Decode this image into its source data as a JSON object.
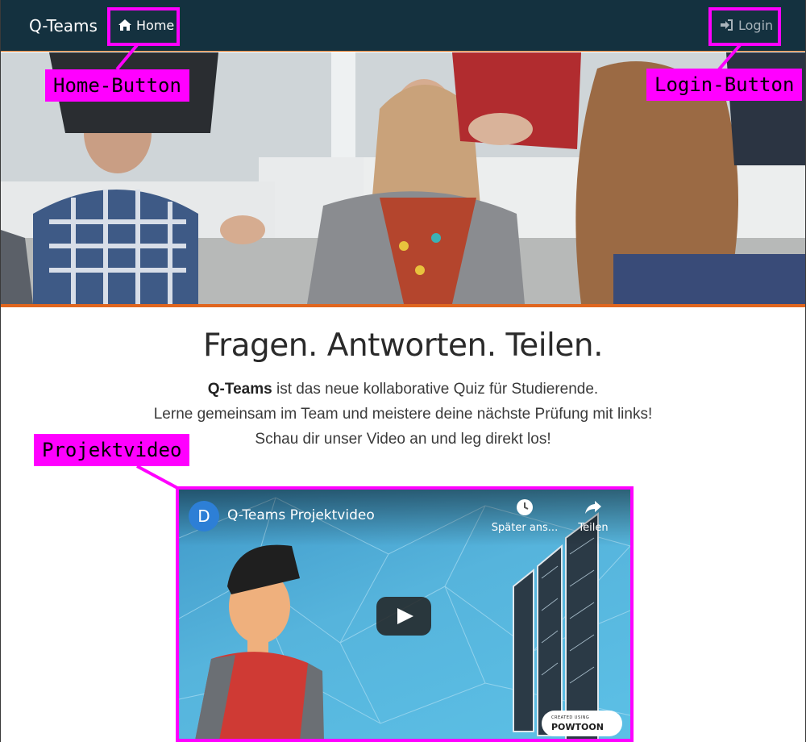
{
  "navbar": {
    "brand": "Q-Teams",
    "home_label": "Home",
    "login_label": "Login"
  },
  "annotations": {
    "home": "Home-Button",
    "login": "Login-Button",
    "video": "Projektvideo"
  },
  "content": {
    "headline": "Fragen. Antworten. Teilen.",
    "intro_brand": "Q-Teams",
    "intro_line1_rest": " ist das neue kollaborative Quiz für Studierende.",
    "intro_line2": "Lerne gemeinsam im Team und meistere deine nächste Prüfung mit links!",
    "intro_line3": "Schau dir unser Video an und leg direkt los!"
  },
  "video": {
    "channel_initial": "D",
    "title": "Q-Teams Projektvideo",
    "watch_later": "Später ans...",
    "share": "Teilen",
    "badge_small": "CREATED USING",
    "badge": "POWTOON"
  },
  "colors": {
    "navbar": "#14313f",
    "accent": "#e0661f",
    "highlight": "#ff00ff"
  },
  "icons": [
    "home-icon",
    "login-icon",
    "clock-icon",
    "share-icon",
    "play-icon"
  ]
}
